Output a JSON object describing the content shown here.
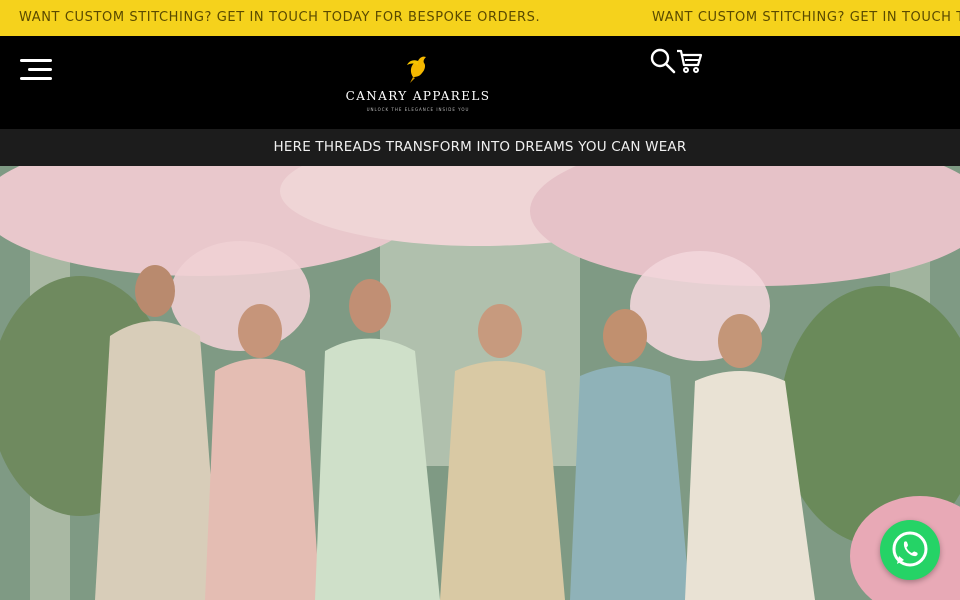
{
  "announcement": {
    "text": "WANT CUSTOM STITCHING? GET IN TOUCH TODAY FOR BESPOKE ORDERS.",
    "text_repeat": "WANT CUSTOM STITCHING? GET IN TOUCH T",
    "bg_color": "#f5d21c"
  },
  "header": {
    "menu_icon": "hamburger-menu-icon",
    "logo": {
      "brand": "CANARY APPARELS",
      "tagline": "UNLOCK THE ELEGANCE INSIDE YOU",
      "icon": "canary-bird-logo"
    },
    "search_icon": "search-icon",
    "cart_icon": "cart-icon"
  },
  "tagline_bar": {
    "text": "HERE THREADS TRANSFORM INTO DREAMS YOU CAN WEAR"
  },
  "hero": {
    "image": "hero-banner-image"
  },
  "whatsapp": {
    "icon": "whatsapp-icon",
    "color": "#25d366"
  }
}
